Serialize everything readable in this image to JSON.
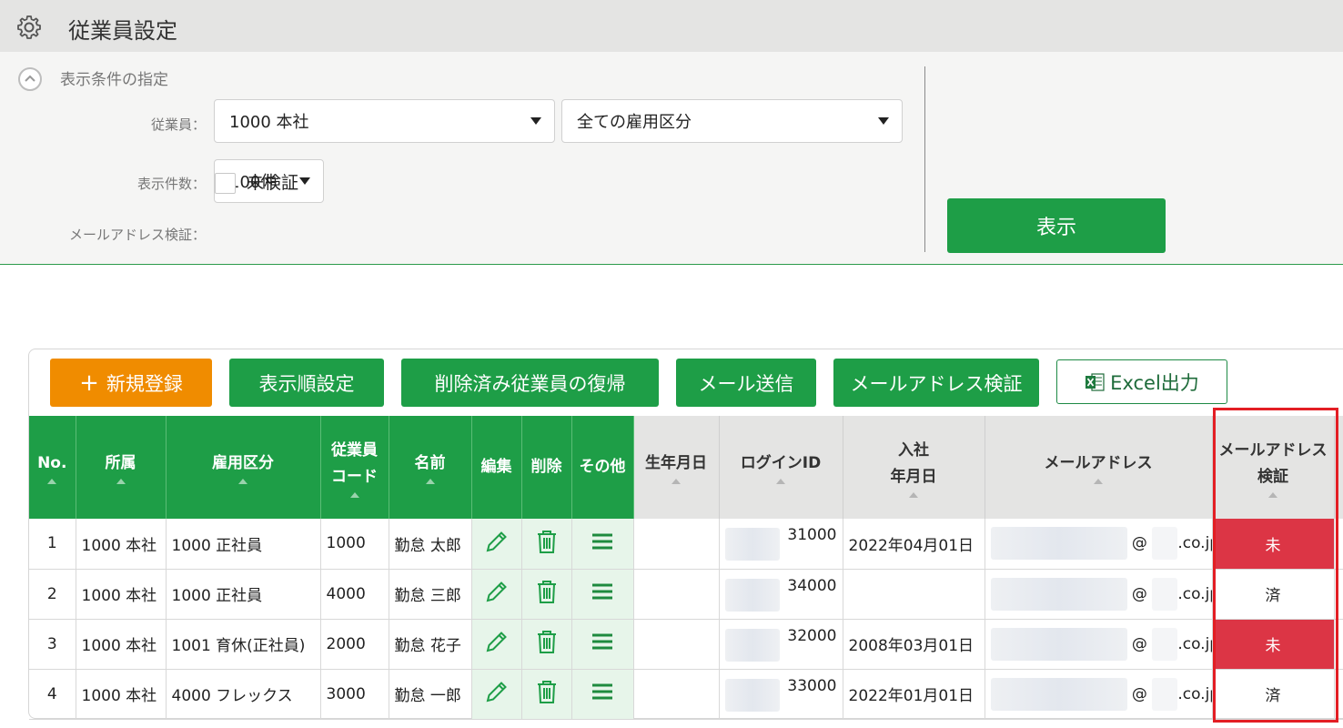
{
  "header": {
    "title": "従業員設定",
    "icon": "gear-icon"
  },
  "filter": {
    "title": "表示条件の指定",
    "employee_label": "従業員：",
    "employee_value": "1000 本社",
    "employment_value": "全ての雇用区分",
    "count_label": "表示件数：",
    "count_value": "100件",
    "email_verify_label": "メールアドレス検証：",
    "unverified_label": "未検証",
    "unverified_checked": false,
    "show_button": "表示"
  },
  "toolbar": {
    "new": "新規登録",
    "order": "表示順設定",
    "restore": "削除済み従業員の復帰",
    "send_mail": "メール送信",
    "verify_mail": "メールアドレス検証",
    "excel": "Excel出力"
  },
  "table": {
    "headers": {
      "no": "No.",
      "dept": "所属",
      "employment": "雇用区分",
      "code_1": "従業員",
      "code_2": "コード",
      "name": "名前",
      "edit": "編集",
      "delete": "削除",
      "other": "その他",
      "birth": "生年月日",
      "login": "ログインID",
      "join_1": "入社",
      "join_2": "年月日",
      "email": "メールアドレス",
      "verify_1": "メールアドレス",
      "verify_2": "検証"
    },
    "rows": [
      {
        "no": "1",
        "dept": "1000 本社",
        "employment": "1000 正社員",
        "code": "1000",
        "name": "勤怠 太郎",
        "birth": "",
        "login": "31000",
        "join": "2022年04月01日",
        "email_at": "@",
        "email_domain": ".co.jp",
        "verify": "未",
        "verified": false
      },
      {
        "no": "2",
        "dept": "1000 本社",
        "employment": "1000 正社員",
        "code": "4000",
        "name": "勤怠 三郎",
        "birth": "",
        "login": "34000",
        "join": "",
        "email_at": "@",
        "email_domain": ".co.jp",
        "verify": "済",
        "verified": true
      },
      {
        "no": "3",
        "dept": "1000 本社",
        "employment": "1001 育休(正社員)",
        "code": "2000",
        "name": "勤怠 花子",
        "birth": "",
        "login": "32000",
        "join": "2008年03月01日",
        "email_at": "@",
        "email_domain": ".co.jp",
        "verify": "未",
        "verified": false
      },
      {
        "no": "4",
        "dept": "1000 本社",
        "employment": "4000 フレックス",
        "code": "3000",
        "name": "勤怠 一郎",
        "birth": "",
        "login": "33000",
        "join": "2022年01月01日",
        "email_at": "@",
        "email_domain": ".co.jp",
        "verify": "済",
        "verified": true
      }
    ]
  },
  "colors": {
    "green": "#1e9e47",
    "orange": "#f08c00",
    "red": "#dc3545",
    "highlight": "#e31e24"
  }
}
